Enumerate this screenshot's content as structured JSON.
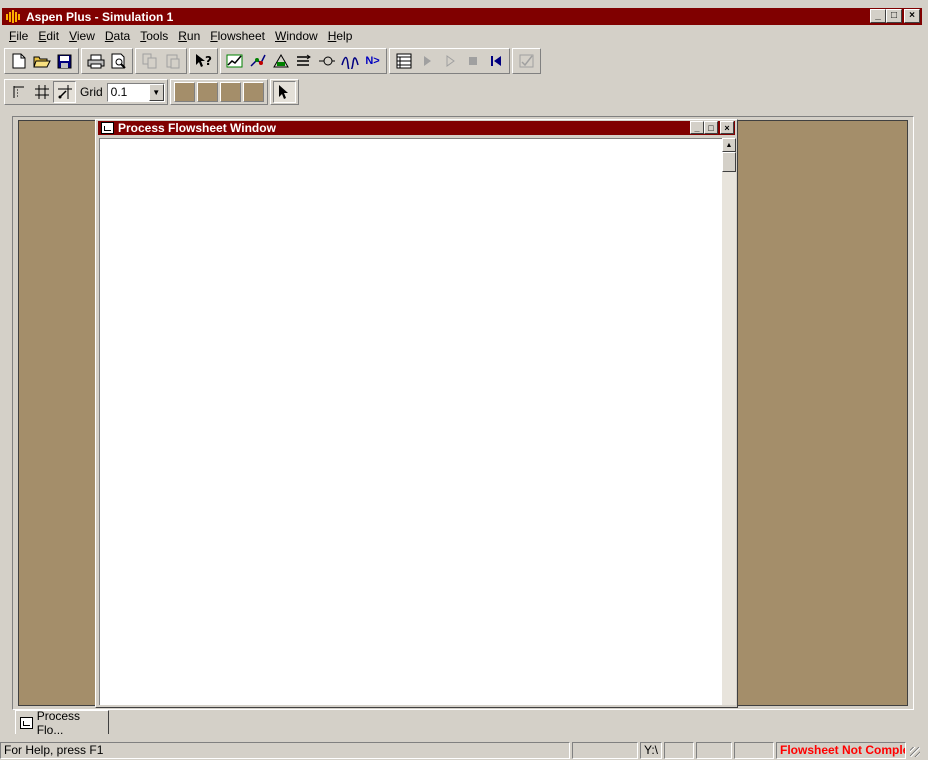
{
  "window": {
    "title": "Aspen Plus - Simulation 1",
    "controls": {
      "minimize": "_",
      "maximize": "□",
      "close": "×"
    }
  },
  "menu": [
    {
      "label": "File",
      "hotkey": "F",
      "rest": "ile"
    },
    {
      "label": "Edit",
      "hotkey": "E",
      "rest": "dit"
    },
    {
      "label": "View",
      "hotkey": "V",
      "rest": "iew"
    },
    {
      "label": "Data",
      "hotkey": "D",
      "rest": "ata"
    },
    {
      "label": "Tools",
      "hotkey": "T",
      "rest": "ools"
    },
    {
      "label": "Run",
      "hotkey": "R",
      "rest": "un"
    },
    {
      "label": "Flowsheet",
      "hotkey": "F",
      "rest": "lowsheet"
    },
    {
      "label": "Window",
      "hotkey": "W",
      "rest": "indow"
    },
    {
      "label": "Help",
      "hotkey": "H",
      "rest": "elp"
    }
  ],
  "toolbar": {
    "buttons": {
      "new": "new-document-icon",
      "open": "open-folder-icon",
      "save": "save-disk-icon",
      "print": "printer-icon",
      "print_preview": "print-preview-icon",
      "copy": "copy-icon",
      "paste": "paste-icon",
      "whats_this": "context-help-icon",
      "next_label": "N>"
    },
    "grid_label": "Grid",
    "grid_value": "0.1"
  },
  "flowsheet_window": {
    "title": "Process Flowsheet Window",
    "controls": {
      "minimize": "_",
      "maximize": "□",
      "close": "×"
    }
  },
  "tabs": [
    {
      "label": "Process Flo..."
    }
  ],
  "status": {
    "help": "For Help, press F1",
    "drive": "Y:\\",
    "state": "Flowsheet Not Complete"
  },
  "colors": {
    "title_bar": "#800000",
    "workspace": "#a48e6a",
    "chrome": "#d4d0c8",
    "status_warning": "#ff0000"
  }
}
